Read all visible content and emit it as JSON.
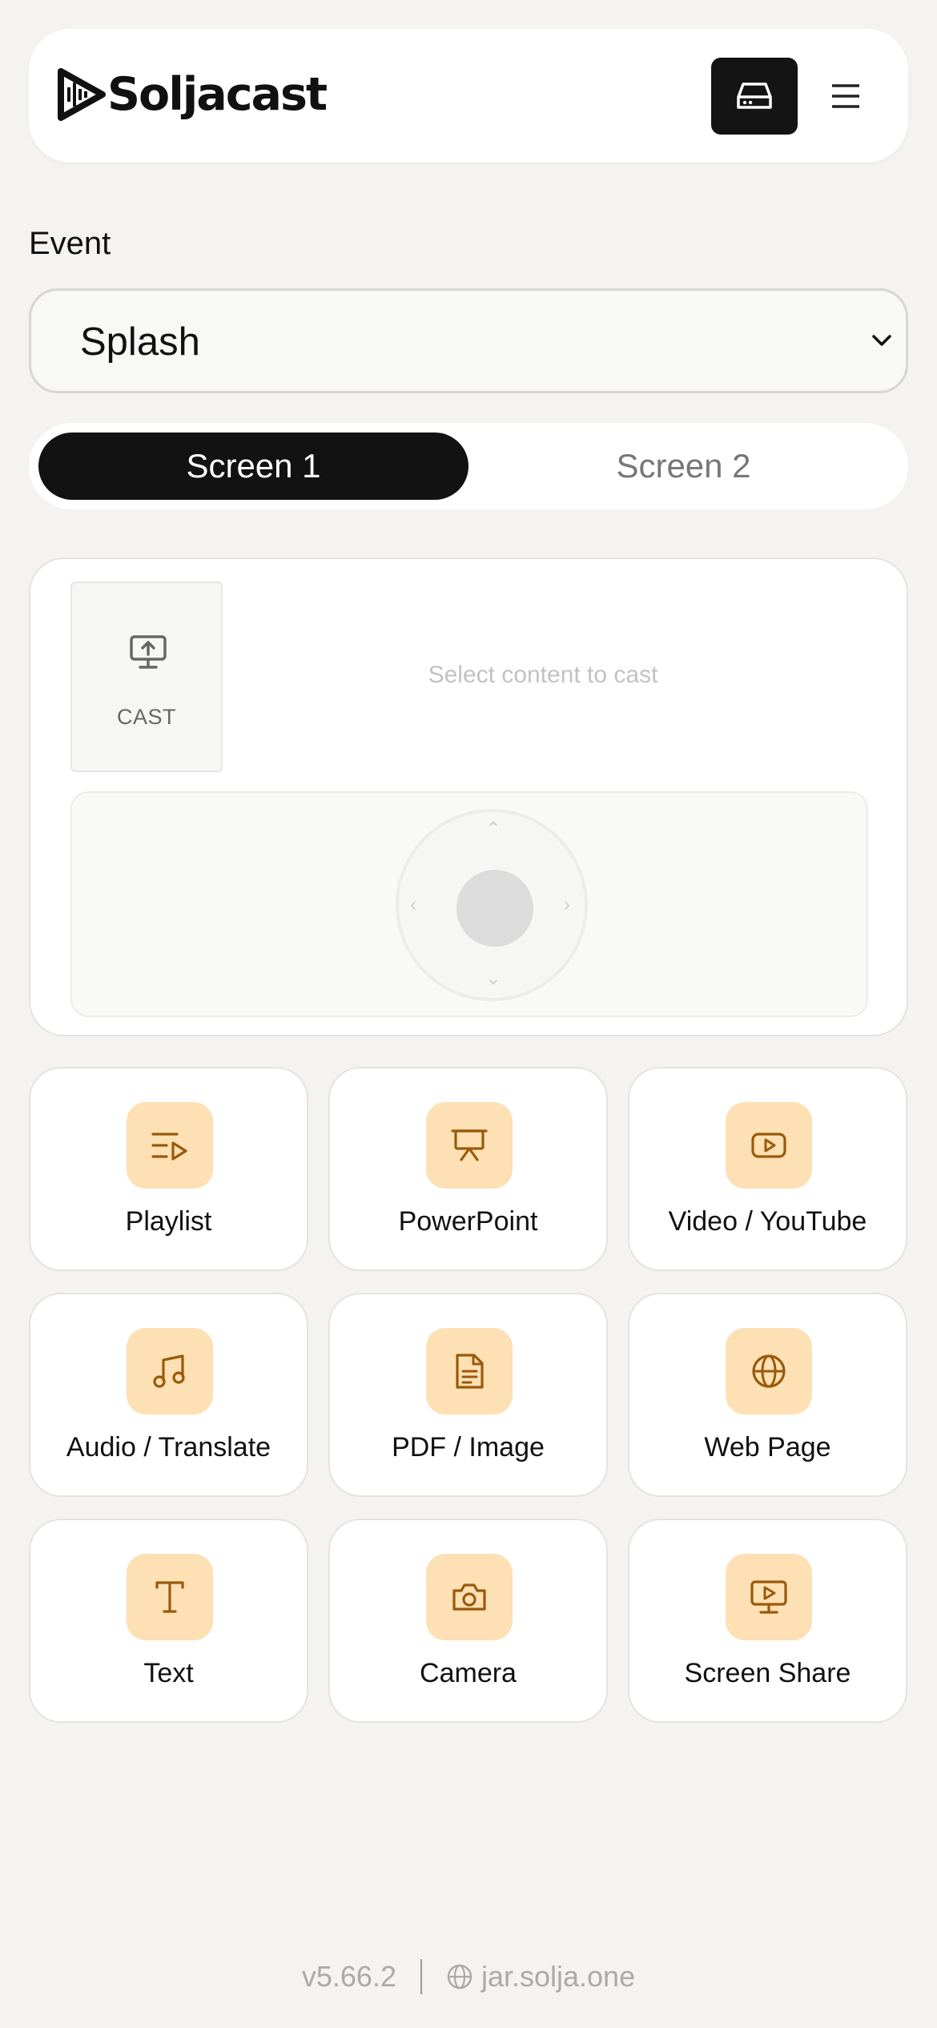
{
  "app": {
    "name": "Soljacast"
  },
  "header": {
    "drive_icon": "drive-icon",
    "menu_icon": "hamburger-menu-icon"
  },
  "event": {
    "label": "Event",
    "selected": "Splash"
  },
  "screens": {
    "tabs": [
      {
        "label": "Screen 1",
        "active": true
      },
      {
        "label": "Screen 2",
        "active": false
      }
    ]
  },
  "preview": {
    "cast_label": "CAST",
    "empty_message": "Select content to cast"
  },
  "content_types": [
    {
      "label": "Playlist",
      "icon": "playlist-icon"
    },
    {
      "label": "PowerPoint",
      "icon": "presentation-icon"
    },
    {
      "label": "Video / YouTube",
      "icon": "video-icon"
    },
    {
      "label": "Audio / Translate",
      "icon": "music-icon"
    },
    {
      "label": "PDF / Image",
      "icon": "document-icon"
    },
    {
      "label": "Web Page",
      "icon": "globe-icon"
    },
    {
      "label": "Text",
      "icon": "text-icon"
    },
    {
      "label": "Camera",
      "icon": "camera-icon"
    },
    {
      "label": "Screen Share",
      "icon": "screen-share-icon"
    }
  ],
  "footer": {
    "version": "v5.66.2",
    "site": "jar.solja.one"
  },
  "colors": {
    "accent_bg": "#fde0b4",
    "accent_icon": "#9a5a0a",
    "dark": "#121212",
    "page_bg": "#f4f3f1"
  }
}
